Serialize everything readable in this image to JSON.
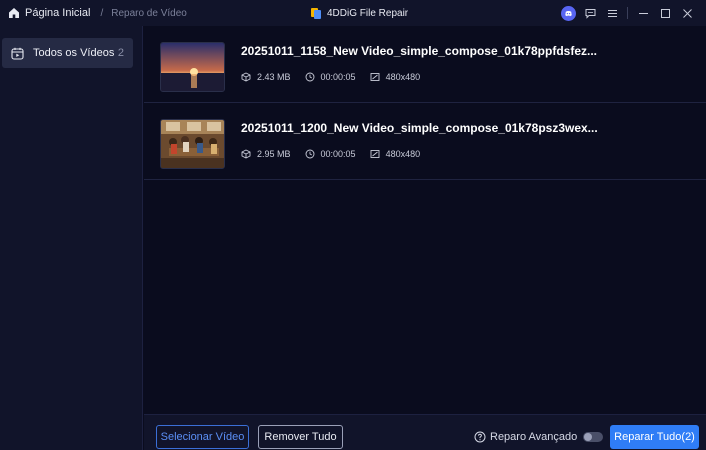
{
  "titlebar": {
    "home_label": "Página Inicial",
    "separator": "/",
    "breadcrumb_current": "Reparo de Vídeo",
    "app_title": "4DDiG File Repair"
  },
  "sidebar": {
    "items": [
      {
        "label": "Todos os Vídeos",
        "count": "2",
        "icon": "calendar-video-icon"
      }
    ]
  },
  "videos": [
    {
      "filename": "20251011_1158_New Video_simple_compose_01k78ppfdsfez...",
      "size": "2.43 MB",
      "duration": "00:00:05",
      "resolution": "480x480",
      "thumbnail": "sunset-over-sea"
    },
    {
      "filename": "20251011_1200_New Video_simple_compose_01k78psz3wex...",
      "size": "2.95 MB",
      "duration": "00:00:05",
      "resolution": "480x480",
      "thumbnail": "people-at-table"
    }
  ],
  "bottombar": {
    "select_label": "Selecionar Vídeo",
    "remove_label": "Remover Tudo",
    "advanced_label": "Reparo Avançado",
    "advanced_enabled": false,
    "repair_label": "Reparar Tudo(2)"
  },
  "colors": {
    "accent": "#2f7df6",
    "background": "#0a0c1e",
    "panel": "#11142a"
  }
}
